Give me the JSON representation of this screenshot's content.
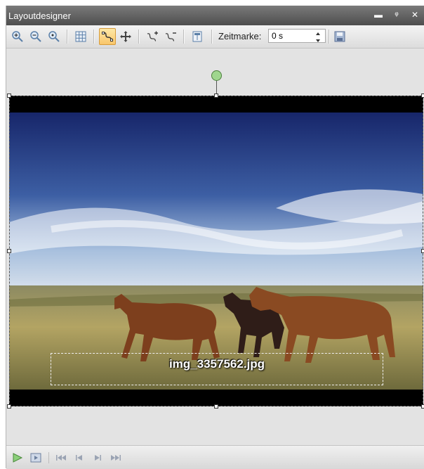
{
  "window": {
    "title": "Layoutdesigner"
  },
  "titlebar_buttons": {
    "minimize": "▬",
    "pin": "ᵠ",
    "close": "✕"
  },
  "toolbar": {
    "zeitmarke_label": "Zeitmarke:",
    "zeitmarke_value": "0 s",
    "icons": [
      "zoom-in-icon",
      "zoom-out-icon",
      "zoom-fit-icon",
      "grid-icon",
      "path-icon",
      "move-icon",
      "add-point-icon",
      "remove-point-icon",
      "align-icon",
      "save-icon"
    ]
  },
  "canvas": {
    "caption": "img_3357562.jpg"
  },
  "playback": {
    "icons": [
      "play-icon",
      "preview-icon",
      "first-frame-icon",
      "previous-frame-icon",
      "next-frame-icon",
      "last-frame-icon"
    ]
  },
  "colors": {
    "sky_top": "#1a2b6e",
    "sky_bottom": "#c7d8ea",
    "grass": "#a89a55",
    "horse": "#7a3f1c",
    "active_tool": "#f9c66b",
    "rotation_handle": "#9fd68e"
  }
}
